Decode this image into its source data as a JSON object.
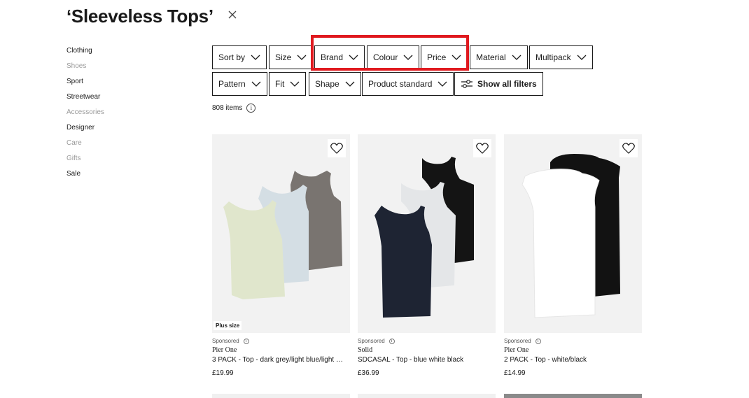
{
  "page": {
    "title": "‘Sleeveless Tops’",
    "item_count": "808 items",
    "info_symbol": "i"
  },
  "sidebar": {
    "items": [
      {
        "label": "Clothing",
        "style": "strong"
      },
      {
        "label": "Shoes",
        "style": "muted"
      },
      {
        "label": "Sport",
        "style": "strong"
      },
      {
        "label": "Streetwear",
        "style": "strong"
      },
      {
        "label": "Accessories",
        "style": "muted"
      },
      {
        "label": "Designer",
        "style": "strong"
      },
      {
        "label": "Care",
        "style": "muted"
      },
      {
        "label": "Gifts",
        "style": "muted"
      },
      {
        "label": "Sale",
        "style": "strong"
      }
    ]
  },
  "filters": {
    "row1": [
      "Sort by",
      "Size",
      "Brand",
      "Colour",
      "Price",
      "Material",
      "Multipack"
    ],
    "row2": [
      "Pattern",
      "Fit",
      "Shape",
      "Product standard"
    ],
    "show_all": "Show all filters",
    "highlighted": [
      "Brand",
      "Colour",
      "Price"
    ],
    "highlight_color": "#e0191f"
  },
  "products": [
    {
      "badge": "Plus size",
      "sponsored": "Sponsored",
      "brand": "Pier One",
      "name": "3 PACK - Top - dark grey/light blue/light …",
      "price": "£19.99",
      "colors": [
        "#797470",
        "#d4dee4",
        "#e0e6cc"
      ]
    },
    {
      "badge": "",
      "sponsored": "Sponsored",
      "brand": "Solid",
      "name": "SDCASAL - Top - blue white black",
      "price": "£36.99",
      "colors": [
        "#141414",
        "#e4e6e8",
        "#1e2433"
      ]
    },
    {
      "badge": "",
      "sponsored": "Sponsored",
      "brand": "Pier One",
      "name": "2 PACK - Top - white/black",
      "price": "£14.99",
      "colors": [
        "#121212",
        "#ffffff"
      ]
    }
  ]
}
